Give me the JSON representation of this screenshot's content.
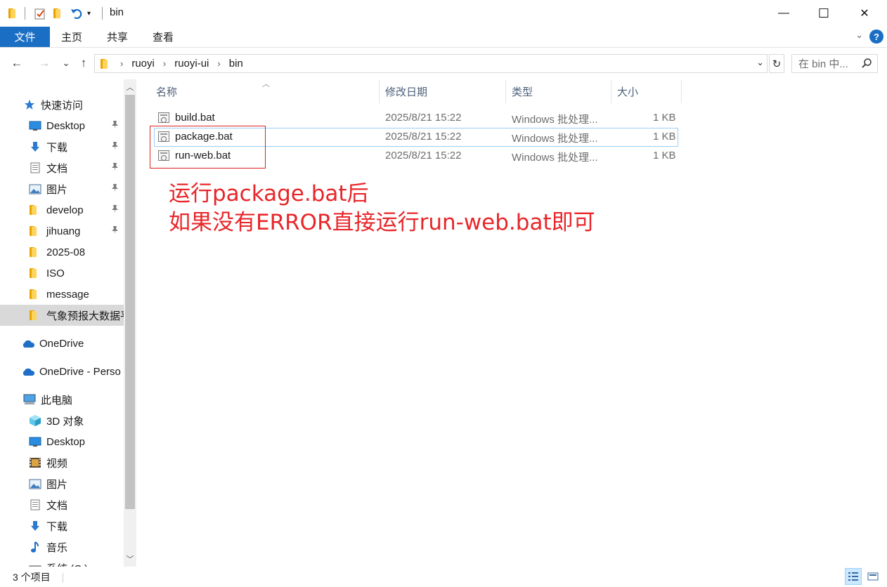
{
  "window": {
    "title": "bin",
    "minimize_glyph": "—",
    "maximize_glyph": "☐",
    "close_glyph": "✕"
  },
  "ribbon": {
    "tabs": [
      "文件",
      "主页",
      "共享",
      "查看"
    ],
    "help_label": "?"
  },
  "navigation": {
    "back_glyph": "←",
    "forward_glyph": "→",
    "recent_glyph": "⌄",
    "up_glyph": "↑",
    "breadcrumbs": [
      "ruoyi",
      "ruoyi-ui",
      "bin"
    ],
    "breadcrumb_separator": "›",
    "refresh_glyph": "↻",
    "search_placeholder": "在 bin 中..."
  },
  "sidebar": {
    "items": [
      {
        "label": "快速访问",
        "icon": "star-icon",
        "pinned": false
      },
      {
        "label": "Desktop",
        "icon": "desktop-icon",
        "pinned": true
      },
      {
        "label": "下载",
        "icon": "download-icon",
        "pinned": true
      },
      {
        "label": "文档",
        "icon": "document-icon",
        "pinned": true
      },
      {
        "label": "图片",
        "icon": "picture-icon",
        "pinned": true
      },
      {
        "label": "develop",
        "icon": "folder-icon",
        "pinned": true
      },
      {
        "label": "jihuang",
        "icon": "folder-icon",
        "pinned": true
      },
      {
        "label": "2025-08",
        "icon": "folder-icon",
        "pinned": false
      },
      {
        "label": "ISO",
        "icon": "folder-icon",
        "pinned": false
      },
      {
        "label": "message",
        "icon": "folder-icon",
        "pinned": false
      },
      {
        "label": "气象预报大数据平",
        "icon": "folder-icon",
        "pinned": false,
        "selected": true
      },
      {
        "label": "OneDrive",
        "icon": "cloud-icon",
        "pinned": false
      },
      {
        "label": "OneDrive - Perso",
        "icon": "cloud-icon",
        "pinned": false
      },
      {
        "label": "此电脑",
        "icon": "computer-icon",
        "pinned": false
      },
      {
        "label": "3D 对象",
        "icon": "cube-icon",
        "pinned": false
      },
      {
        "label": "Desktop",
        "icon": "desktop-icon",
        "pinned": false
      },
      {
        "label": "视频",
        "icon": "video-icon",
        "pinned": false
      },
      {
        "label": "图片",
        "icon": "picture-icon",
        "pinned": false
      },
      {
        "label": "文档",
        "icon": "document-icon",
        "pinned": false
      },
      {
        "label": "下载",
        "icon": "download-icon",
        "pinned": false
      },
      {
        "label": "音乐",
        "icon": "music-icon",
        "pinned": false
      },
      {
        "label": "系统 (C:)",
        "icon": "drive-icon",
        "pinned": false
      }
    ],
    "pin_glyph": "📌"
  },
  "file_list": {
    "columns": [
      "名称",
      "修改日期",
      "类型",
      "大小"
    ],
    "files": [
      {
        "name": "build.bat",
        "modified": "2025/8/21 15:22",
        "type": "Windows 批处理...",
        "size": "1 KB"
      },
      {
        "name": "package.bat",
        "modified": "2025/8/21 15:22",
        "type": "Windows 批处理...",
        "size": "1 KB"
      },
      {
        "name": "run-web.bat",
        "modified": "2025/8/21 15:22",
        "type": "Windows 批处理...",
        "size": "1 KB"
      }
    ]
  },
  "annotation": {
    "line1": "运行package.bat后",
    "line2": "如果没有ERROR直接运行run-web.bat即可",
    "color": "#e8262a"
  },
  "status": {
    "item_count": "3 个项目"
  },
  "colors": {
    "accent": "#1a6fc4",
    "selection_border": "#99d1ff",
    "annotation_red": "#e02020"
  }
}
